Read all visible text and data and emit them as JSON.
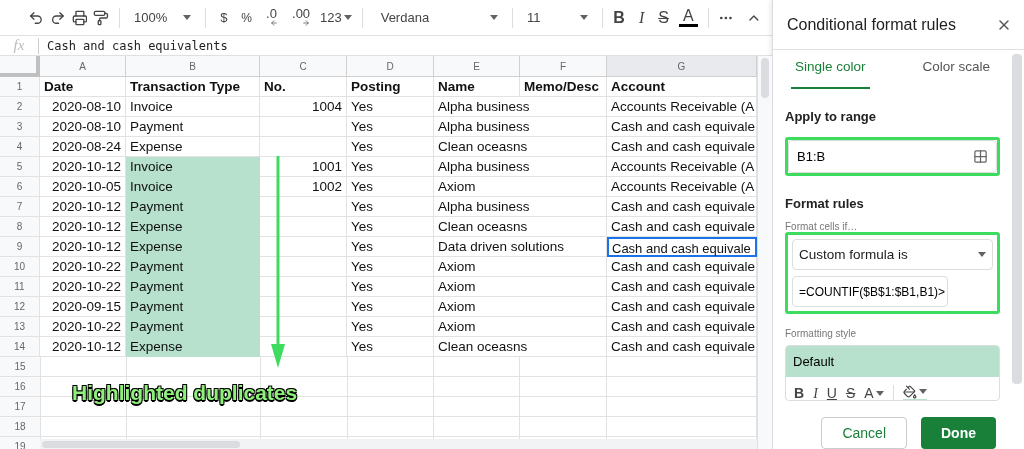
{
  "toolbar": {
    "zoom": "100%",
    "currency": "$",
    "percent": "%",
    "decrease_decimals": ".0",
    "increase_decimals": ".00",
    "number_format": "123",
    "font": "Verdana",
    "font_size": "11",
    "bold": "B",
    "italic": "I",
    "strikethrough": "S",
    "text_color": "A"
  },
  "formula_bar": {
    "label": "fx",
    "value": "Cash and cash equivalents"
  },
  "sheet": {
    "columns": [
      "A",
      "B",
      "C",
      "D",
      "E",
      "F",
      "G"
    ],
    "header_row": {
      "number": "1",
      "cells": [
        "Date",
        "Transaction Type",
        "No.",
        "Posting",
        "Name",
        "Memo/Desc",
        "Account"
      ]
    },
    "rows": [
      {
        "number": "2",
        "date": "2020-08-10",
        "type": "Invoice",
        "no": "1004",
        "posting": "Yes",
        "name": "Alpha business",
        "account": "Accounts Receivable (A",
        "highlighted": false,
        "account_selected": false
      },
      {
        "number": "3",
        "date": "2020-08-10",
        "type": "Payment",
        "posting": "Yes",
        "name": "Alpha business",
        "account": "Cash and cash equivale",
        "highlighted": false,
        "account_selected": false
      },
      {
        "number": "4",
        "date": "2020-08-24",
        "type": "Expense",
        "posting": "Yes",
        "name": "Clean oceasns",
        "account": "Cash and cash equivale",
        "highlighted": false,
        "account_selected": false
      },
      {
        "number": "5",
        "date": "2020-10-12",
        "type": "Invoice",
        "no": "1001",
        "posting": "Yes",
        "name": "Alpha business",
        "account": "Accounts Receivable (A",
        "highlighted": true,
        "account_selected": false
      },
      {
        "number": "6",
        "date": "2020-10-05",
        "type": "Invoice",
        "no": "1002",
        "posting": "Yes",
        "name": "Axiom",
        "account": "Accounts Receivable (A",
        "highlighted": true,
        "account_selected": false
      },
      {
        "number": "7",
        "date": "2020-10-12",
        "type": "Payment",
        "posting": "Yes",
        "name": "Alpha business",
        "account": "Cash and cash equivale",
        "highlighted": true,
        "account_selected": false
      },
      {
        "number": "8",
        "date": "2020-10-12",
        "type": "Expense",
        "posting": "Yes",
        "name": "Clean oceasns",
        "account": "Cash and cash equivale",
        "highlighted": true,
        "account_selected": false
      },
      {
        "number": "9",
        "date": "2020-10-12",
        "type": "Expense",
        "posting": "Yes",
        "name": "Data driven solutions",
        "account": "Cash and cash equivale",
        "highlighted": true,
        "account_selected": true
      },
      {
        "number": "10",
        "date": "2020-10-22",
        "type": "Payment",
        "posting": "Yes",
        "name": "Axiom",
        "account": "Cash and cash equivale",
        "highlighted": true,
        "account_selected": false
      },
      {
        "number": "11",
        "date": "2020-10-22",
        "type": "Payment",
        "posting": "Yes",
        "name": "Axiom",
        "account": "Cash and cash equivale",
        "highlighted": true,
        "account_selected": false
      },
      {
        "number": "12",
        "date": "2020-09-15",
        "type": "Payment",
        "posting": "Yes",
        "name": "Axiom",
        "account": "Cash and cash equivale",
        "highlighted": true,
        "account_selected": false
      },
      {
        "number": "13",
        "date": "2020-10-22",
        "type": "Payment",
        "posting": "Yes",
        "name": "Axiom",
        "account": "Cash and cash equivale",
        "highlighted": true,
        "account_selected": false
      },
      {
        "number": "14",
        "date": "2020-10-12",
        "type": "Expense",
        "posting": "Yes",
        "name": "Clean oceasns",
        "account": "Cash and cash equivale",
        "highlighted": true,
        "account_selected": false
      }
    ],
    "empty_rows": [
      "15",
      "16",
      "17",
      "18",
      "19"
    ]
  },
  "annotation": {
    "label": "Highlighted duplicates"
  },
  "panel": {
    "title": "Conditional format rules",
    "tabs": [
      {
        "label": "Single color",
        "selected": true
      },
      {
        "label": "Color scale",
        "selected": false
      }
    ],
    "range_label": "Apply to range",
    "range_value": "B1:B",
    "format_rules_label": "Format rules",
    "condition_label": "Format cells if…",
    "condition": "Custom formula is",
    "formula": "=COUNTIF($B$1:$B1,B1)>",
    "style_label": "Formatting style",
    "style_preview": "Default",
    "style_buttons": [
      {
        "label": "B",
        "kind": "bold"
      },
      {
        "label": "I",
        "kind": "italic"
      },
      {
        "label": "U",
        "kind": "underline"
      },
      {
        "label": "S",
        "kind": "strike"
      },
      {
        "label": "A",
        "kind": "color"
      }
    ],
    "buttons": [
      {
        "label": "Cancel",
        "kind": "secondary"
      },
      {
        "label": "Done",
        "kind": "primary"
      }
    ]
  }
}
